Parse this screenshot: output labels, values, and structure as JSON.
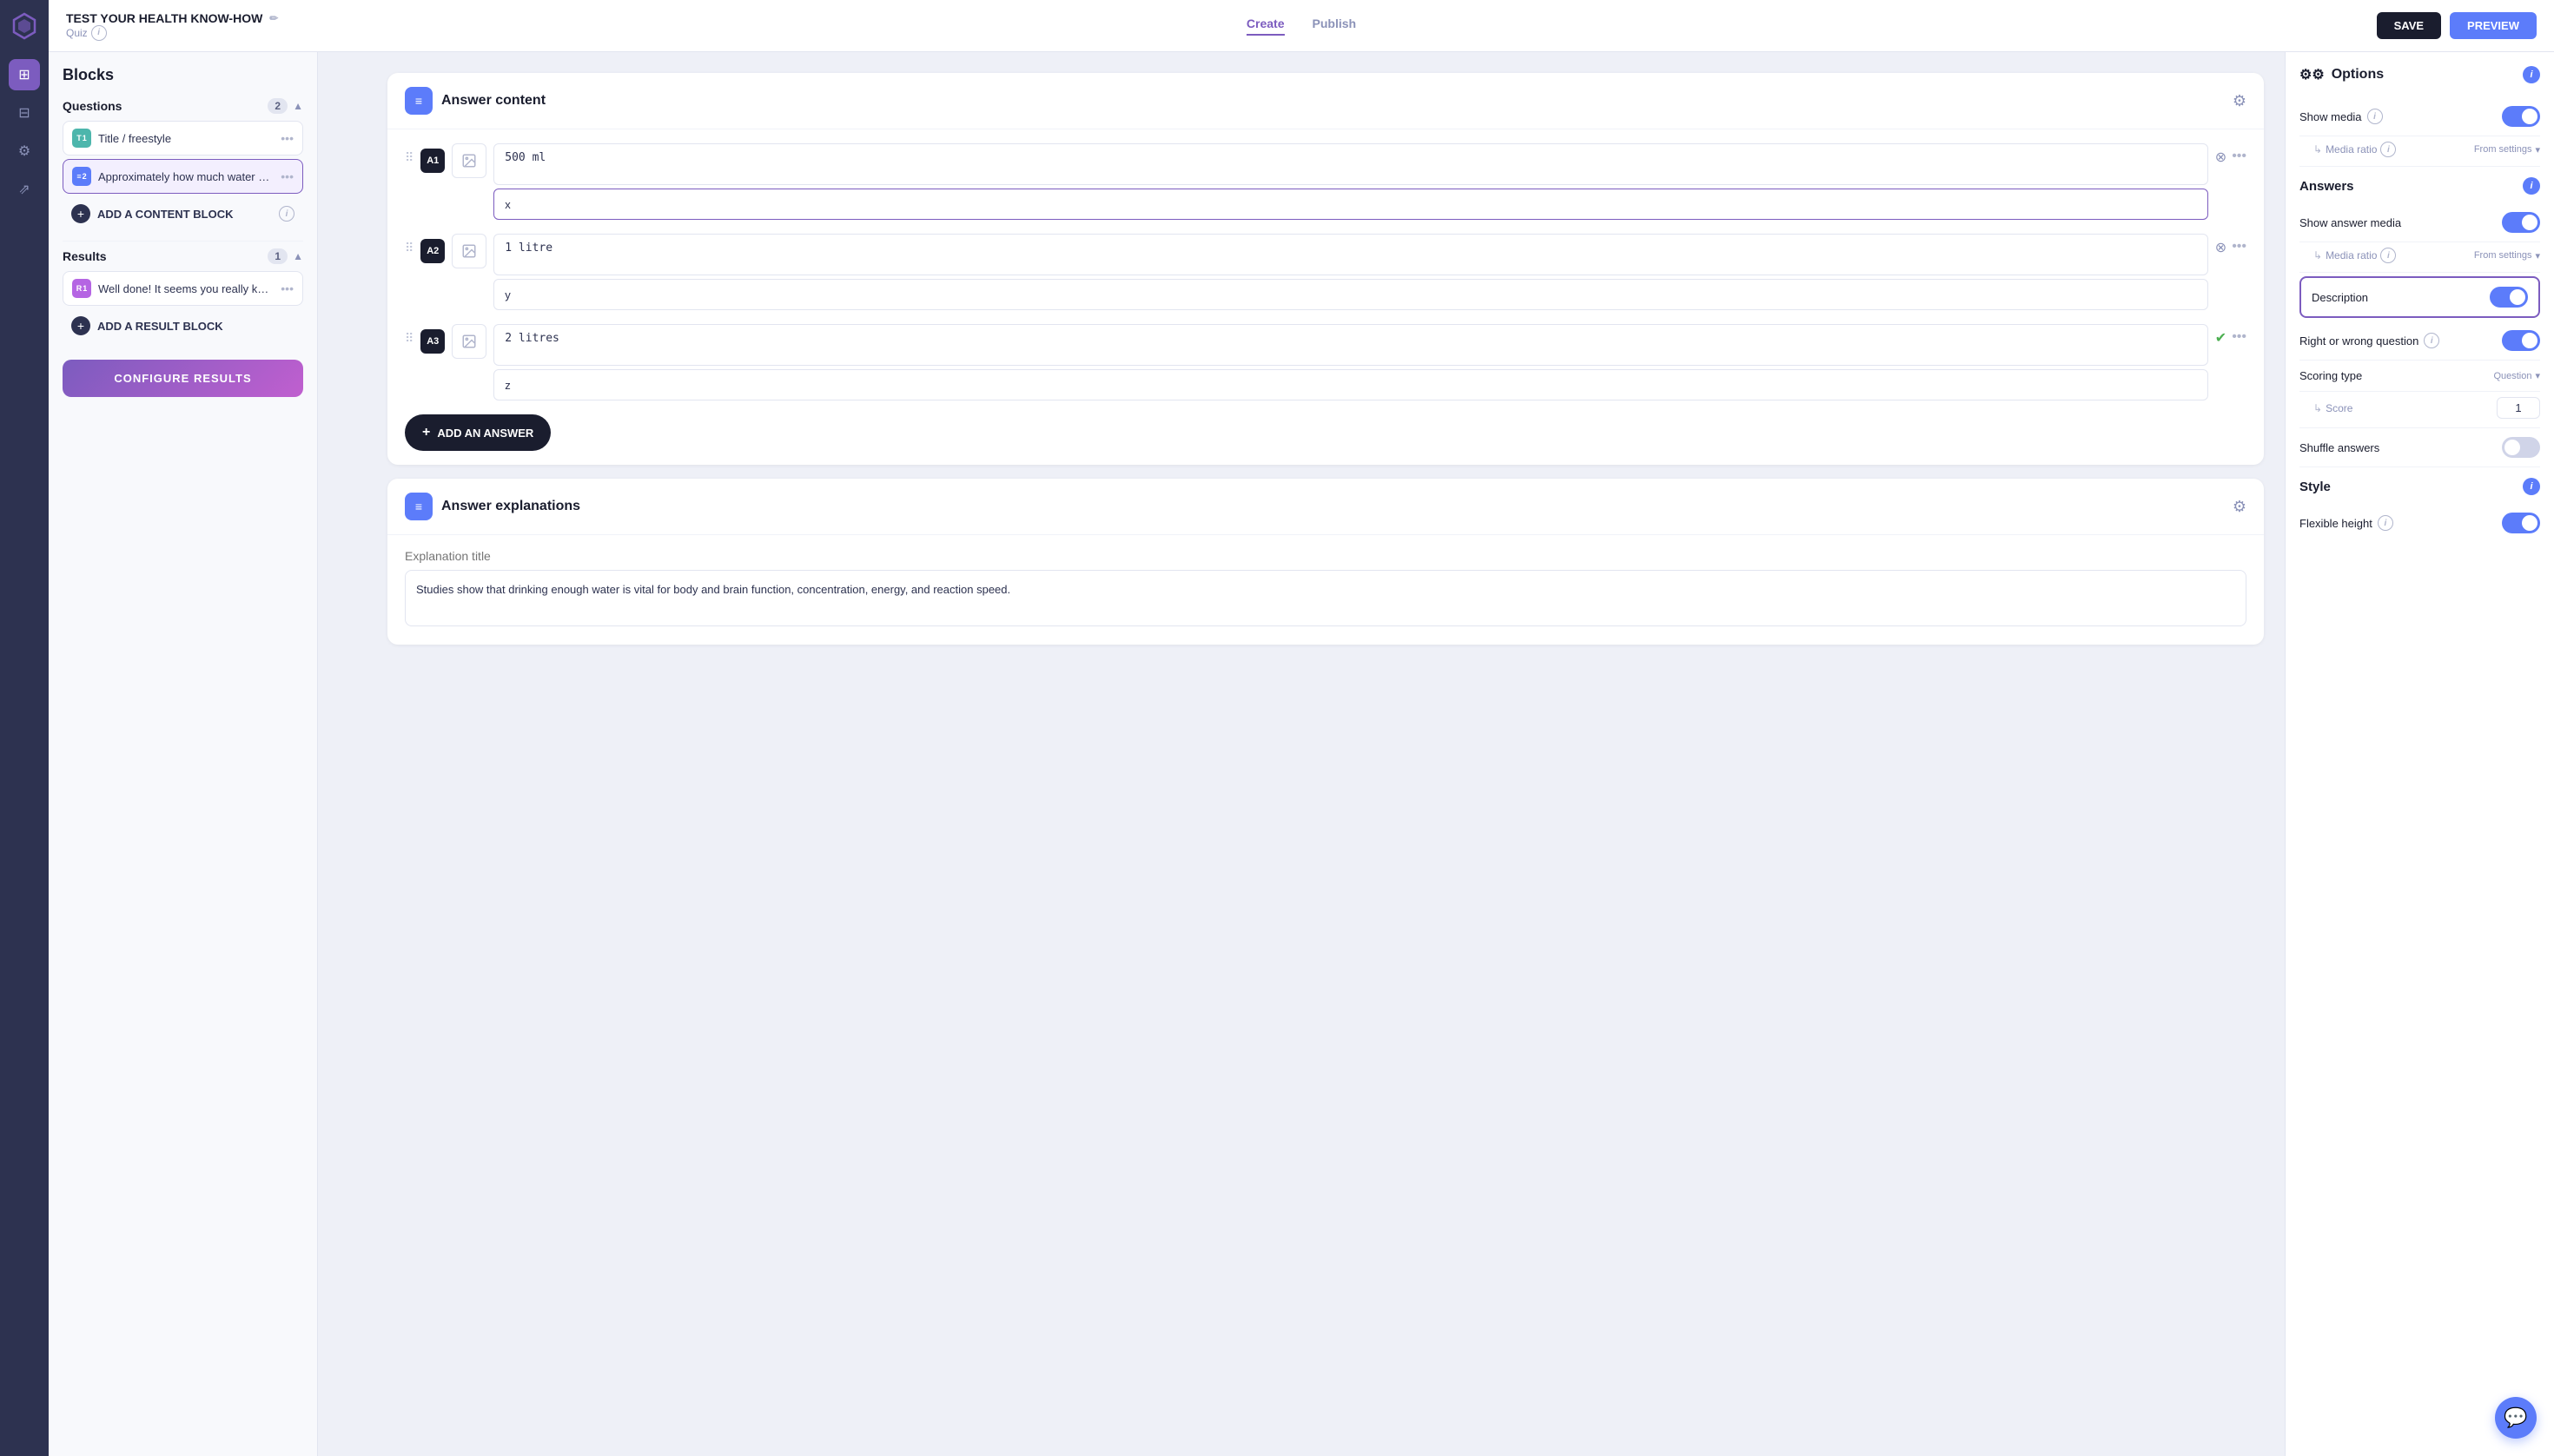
{
  "app": {
    "title": "TEST YOUR HEALTH KNOW-HOW",
    "subtitle": "Quiz",
    "edit_icon": "✏️"
  },
  "topbar": {
    "nav": [
      {
        "id": "create",
        "label": "Create",
        "active": true
      },
      {
        "id": "publish",
        "label": "Publish",
        "active": false
      }
    ],
    "save_label": "SAVE",
    "preview_label": "PREVIEW"
  },
  "sidebar": {
    "title": "Blocks",
    "questions_section": "Questions",
    "questions_count": "2",
    "results_section": "Results",
    "results_count": "1",
    "questions": [
      {
        "id": "q1",
        "badge": "T 1",
        "badge_type": "t",
        "label": "Title / freestyle"
      },
      {
        "id": "q2",
        "badge": "≡ 2",
        "badge_type": "lines",
        "label": "Approximately how much water doe...",
        "active": true
      }
    ],
    "results": [
      {
        "id": "r1",
        "badge": "R 1",
        "badge_type": "r",
        "label": "Well done! It seems you really know ..."
      }
    ],
    "add_content_block": "ADD A CONTENT BLOCK",
    "add_result_block": "ADD A RESULT BLOCK",
    "configure_results": "CONFIGURE RESULTS"
  },
  "answer_content": {
    "title": "Answer content",
    "answers": [
      {
        "id": "A1",
        "value": "500 ml",
        "description": "x",
        "correct": false
      },
      {
        "id": "A2",
        "value": "1 litre",
        "description": "y",
        "correct": false
      },
      {
        "id": "A3",
        "value": "2 litres",
        "description": "z",
        "correct": true
      }
    ],
    "add_answer_label": "ADD AN ANSWER"
  },
  "answer_explanations": {
    "title": "Answer explanations",
    "explanation_title_placeholder": "Explanation title",
    "explanation_text": "Studies show that drinking enough water is vital for body and brain function, concentration, energy, and reaction speed."
  },
  "options_panel": {
    "title": "Options",
    "sections": {
      "show_media": {
        "label": "Show media",
        "enabled": true,
        "media_ratio_label": "Media ratio",
        "media_ratio_value": "From settings"
      },
      "answers": {
        "title": "Answers",
        "show_answer_media_label": "Show answer media",
        "show_answer_media_enabled": true,
        "media_ratio_label": "Media ratio",
        "media_ratio_value": "From settings",
        "description_label": "Description",
        "description_enabled": true,
        "right_or_wrong_label": "Right or wrong question",
        "right_or_wrong_enabled": true,
        "scoring_type_label": "Scoring type",
        "scoring_type_value": "Question",
        "score_label": "Score",
        "score_value": "1",
        "shuffle_answers_label": "Shuffle answers",
        "shuffle_answers_enabled": false
      },
      "style": {
        "title": "Style",
        "flexible_height_label": "Flexible height",
        "flexible_height_enabled": true
      }
    }
  }
}
